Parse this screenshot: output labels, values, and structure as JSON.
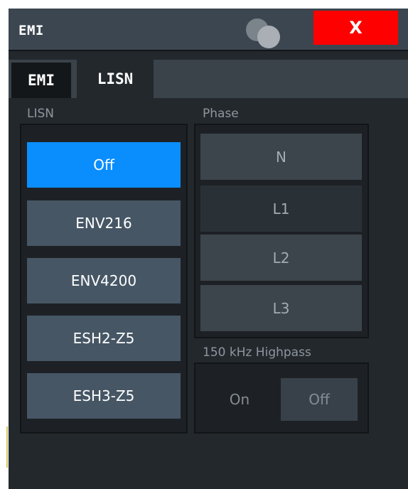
{
  "window": {
    "title": "EMI",
    "close_label": "X"
  },
  "tabs": [
    {
      "label": "EMI",
      "active": false
    },
    {
      "label": "LISN",
      "active": true
    }
  ],
  "lisn": {
    "label": "LISN",
    "options": [
      "Off",
      "ENV216",
      "ENV4200",
      "ESH2-Z5",
      "ESH3-Z5"
    ],
    "selected": "Off"
  },
  "phase": {
    "label": "Phase",
    "options": [
      "N",
      "L1",
      "L2",
      "L3"
    ],
    "selected": "L1"
  },
  "highpass": {
    "label": "150 kHz Highpass",
    "on_label": "On",
    "off_label": "Off",
    "selected": "Off"
  },
  "colors": {
    "selected_accent": "#0a8efe",
    "close_button": "#ff0000",
    "dialog_bg": "#23282d"
  }
}
